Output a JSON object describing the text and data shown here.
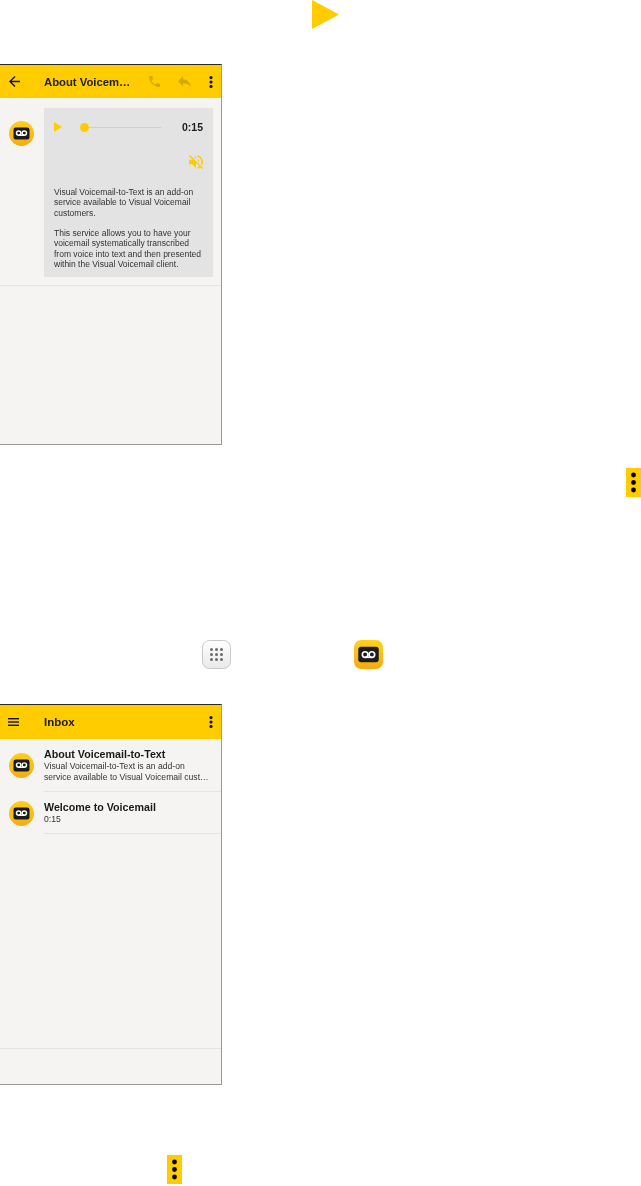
{
  "detail_screen": {
    "app_bar": {
      "title": "About Voicem…",
      "actions": [
        {
          "kind": "call",
          "disabled": true
        },
        {
          "kind": "reply",
          "disabled": true
        }
      ]
    },
    "player": {
      "level": 0,
      "duration": "0:15",
      "muted": true
    },
    "transcript": [
      "Visual Voicemail-to-Text is an add-on service available to Visual Voicemail customers.",
      "This service allows you to have your voicemail systematically transcribed from voice into text and then presented within the Visual Voicemail client."
    ]
  },
  "inbox_screen": {
    "app_bar": {
      "title": "Inbox"
    },
    "messages": [
      {
        "title": "About Voicemail-to-Text",
        "preview": "Visual Voicemail-to-Text is an add-on service available to Visual Voicemail cust…"
      },
      {
        "title": "Welcome to Voicemail",
        "preview": "0:15"
      }
    ]
  }
}
